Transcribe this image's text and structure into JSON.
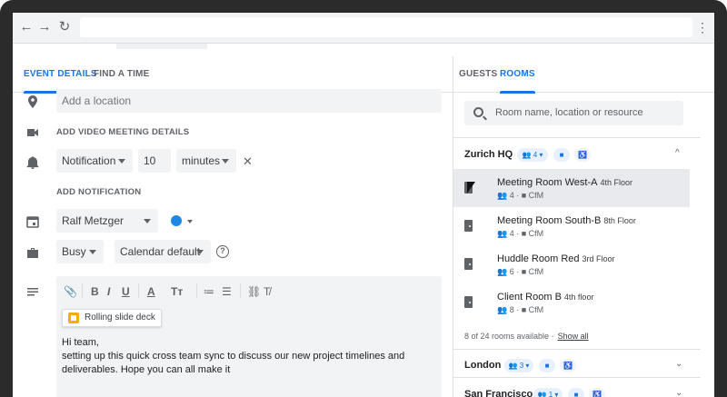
{
  "browser": {
    "nav_back": "←",
    "nav_forward": "→",
    "reload": "↻",
    "menu": "⋮"
  },
  "tabs": {
    "event_details": "EVENT DETAILS",
    "find_a_time": "FIND A TIME"
  },
  "location": {
    "placeholder": "Add a location",
    "icon": "location-pin-icon"
  },
  "video": {
    "label": "ADD VIDEO MEETING DETAILS",
    "icon": "videocam-icon"
  },
  "notification": {
    "type": "Notification",
    "amount": "10",
    "unit": "minutes",
    "remove": "✕",
    "icon": "bell-icon"
  },
  "add_notification": "ADD NOTIFICATION",
  "calendar": {
    "owner": "Ralf Metzger",
    "color": "#1e88e5",
    "icon": "calendar-icon"
  },
  "availability": {
    "status": "Busy",
    "visibility": "Calendar default",
    "help": "?",
    "icon": "briefcase-icon"
  },
  "toolbar": {
    "attach": "📎",
    "bold": "B",
    "italic": "I",
    "underline": "U",
    "text_color": "A",
    "text_size": "Tт",
    "numbered_list": "≔",
    "bulleted_list": "☰",
    "link": "⛓",
    "clear_format": "T̸"
  },
  "attachment": {
    "label": "Rolling slide deck"
  },
  "description": {
    "line1": "Hi team,",
    "line2": "setting up this quick cross team sync to discuss our new project timelines and",
    "line3": "deliverables. Hope you can all make it"
  },
  "right_tabs": {
    "guests": "GUESTS",
    "rooms": "ROOMS"
  },
  "room_search": {
    "placeholder": "Room name, location or resource"
  },
  "locations": [
    {
      "name": "Zurich HQ",
      "capacity_filter": "4",
      "chevron": "^"
    },
    {
      "name": "London",
      "capacity_filter": "3",
      "chevron": "⌄"
    },
    {
      "name": "San Francisco",
      "capacity_filter": "1",
      "chevron": "⌄"
    }
  ],
  "rooms": [
    {
      "name": "Meeting Room West-A",
      "floor": "4th Floor",
      "capacity": "4",
      "video": "CfM"
    },
    {
      "name": "Meeting Room South-B",
      "floor": "8th Floor",
      "capacity": "4",
      "video": "CfM"
    },
    {
      "name": "Huddle Room Red",
      "floor": "3rd Floor",
      "capacity": "6",
      "video": "CfM"
    },
    {
      "name": "Client Room B",
      "floor": "4th floor",
      "capacity": "8",
      "video": "CfM"
    }
  ],
  "rooms_footer": {
    "count": "8 of 24 rooms available ·",
    "show_all": "Show all"
  },
  "colors": {
    "accent": "#1a73e8",
    "field_bg": "#f1f3f4",
    "selected_row": "#e8eaed"
  }
}
